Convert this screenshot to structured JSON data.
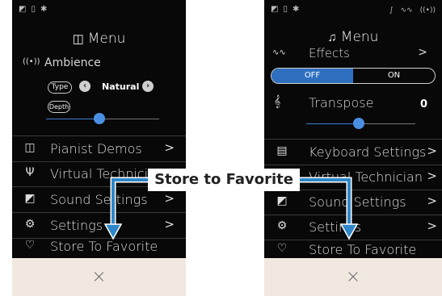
{
  "callout": {
    "text": "Store to Favorite"
  },
  "left_screen": {
    "status_icons": [
      "headphones-icon",
      "battery-icon",
      "bluetooth-icon"
    ],
    "title": "Menu",
    "title_icon": "piano-icon",
    "ambience": {
      "label": "Ambience",
      "type_label": "Type",
      "type_value": "Natural",
      "depth_label": "Depth",
      "depth_level": 0.5
    },
    "items": [
      {
        "label": "Pianist Demos",
        "icon": "piano-icon"
      },
      {
        "label": "Virtual Technician",
        "icon": "tuning-fork-icon"
      },
      {
        "label": "Sound Settings",
        "icon": "headphones-icon"
      },
      {
        "label": "Settings",
        "icon": "gear-icon"
      },
      {
        "label": "Store To Favorite",
        "icon": "heart-icon"
      }
    ],
    "chevron": ">",
    "close": "×"
  },
  "right_screen": {
    "status_icons": [
      "headphones-icon",
      "battery-icon",
      "bluetooth-icon",
      "metronome-icon",
      "effects-icon",
      "ambience-icon"
    ],
    "title": "Menu",
    "title_icon": "music-note-icon",
    "effects": {
      "label": "Effects",
      "off_label": "OFF",
      "on_label": "ON",
      "selected": "OFF"
    },
    "transpose": {
      "label": "Transpose",
      "value": "0",
      "level": 0.5
    },
    "items": [
      {
        "label": "Keyboard Settings",
        "icon": "keyboard-icon"
      },
      {
        "label": "Virtual Technician",
        "icon": "tuning-fork-icon"
      },
      {
        "label": "Sound Settings",
        "icon": "headphones-icon"
      },
      {
        "label": "Settings",
        "icon": "gear-icon"
      },
      {
        "label": "Store To Favorite",
        "icon": "heart-icon"
      }
    ],
    "chevron": ">",
    "close": "×"
  },
  "colors": {
    "accent": "#4a90e2",
    "arrow": "#2f86c8",
    "close_bar": "#f1e8df",
    "screen_bg": "#080808"
  }
}
